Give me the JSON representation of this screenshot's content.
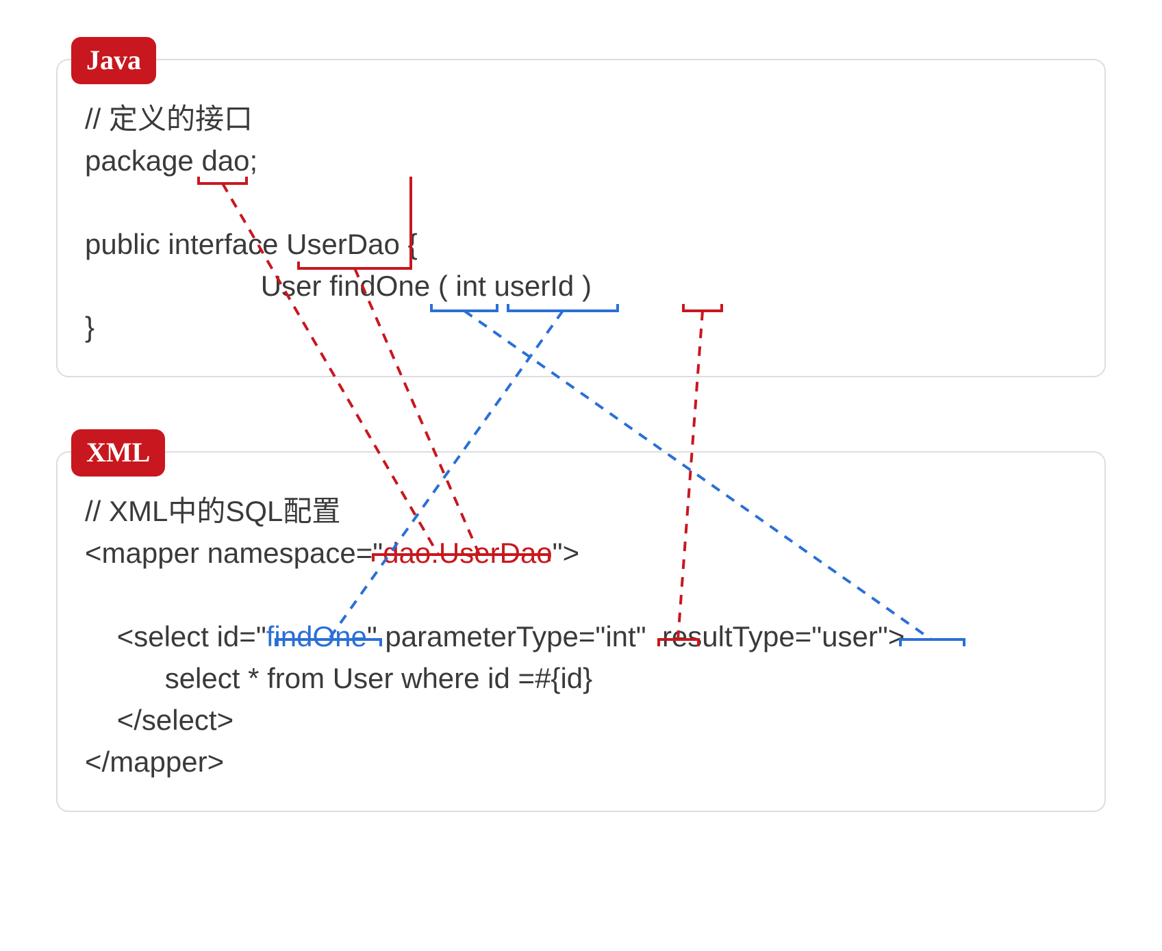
{
  "java": {
    "label": "Java",
    "comment": "// 定义的接口",
    "package_kw": "package ",
    "package_name": "dao",
    "package_semi": ";",
    "interface_prefix": "public interface ",
    "interface_name": "UserDao",
    "interface_open": " {",
    "method_indent": "                      ",
    "method_return": "User",
    "method_space1": " ",
    "method_name": "findOne",
    "method_space2": " ( ",
    "method_param_type": "int",
    "method_space3": " ",
    "method_param_name": "userId",
    "method_close": " )",
    "brace_close": "}"
  },
  "xml": {
    "label": "XML",
    "comment": "// XML中的SQL配置",
    "mapper_open_prefix": "<mapper namespace=\"",
    "namespace": "dao.UserDao",
    "mapper_open_suffix": "\">",
    "select_indent": "    ",
    "select_prefix": "<select id=\"",
    "select_id": "findOne",
    "select_mid1": "\" parameterType=\"",
    "param_type": "int",
    "select_mid2": "\"  resultType=\"",
    "result_type": "user",
    "select_suffix": "\">",
    "sql_indent": "          ",
    "sql_body": "select * from User where id =#{id}",
    "select_close_indent": "    ",
    "select_close": "</select>",
    "mapper_close": "</mapper>"
  }
}
